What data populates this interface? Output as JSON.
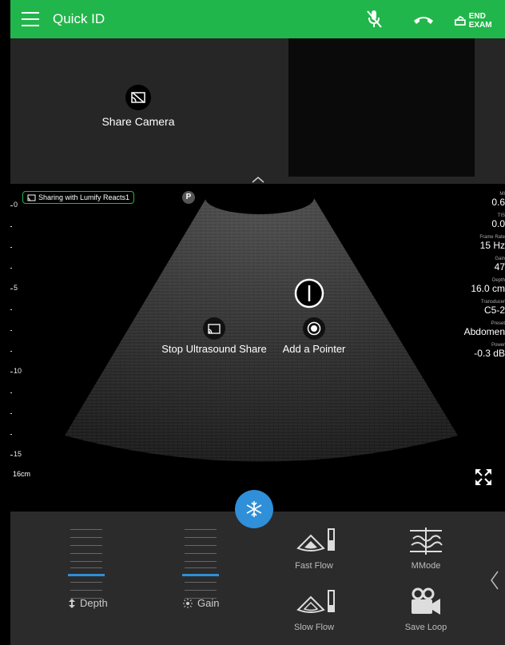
{
  "header": {
    "title": "Quick ID",
    "end_exam_label": "END EXAM"
  },
  "video": {
    "share_camera_label": "Share Camera"
  },
  "ultrasound": {
    "sharing_badge": "Sharing with Lumify Reacts1",
    "p_badge": "P",
    "scale_labels": [
      "0",
      "5",
      "10",
      "15"
    ],
    "depth_marker": "16cm",
    "params": [
      {
        "label": "MI",
        "value": "0.6"
      },
      {
        "label": "TIS",
        "value": "0.0"
      },
      {
        "label": "Frame Rate",
        "value": "15 Hz"
      },
      {
        "label": "Gain",
        "value": "47"
      },
      {
        "label": "Depth",
        "value": "16.0 cm"
      },
      {
        "label": "Transducer",
        "value": "C5-2"
      },
      {
        "label": "Preset",
        "value": "Abdomen"
      },
      {
        "label": "Power",
        "value": "-0.3 dB"
      }
    ],
    "stop_share_label": "Stop Ultrasound Share",
    "add_pointer_label": "Add a Pointer"
  },
  "controls": {
    "depth_label": "Depth",
    "gain_label": "Gain",
    "fast_flow_label": "Fast Flow",
    "mmode_label": "MMode",
    "slow_flow_label": "Slow Flow",
    "save_loop_label": "Save Loop"
  },
  "colors": {
    "brand_green": "#21b64b",
    "accent_blue": "#2f8fd8"
  }
}
